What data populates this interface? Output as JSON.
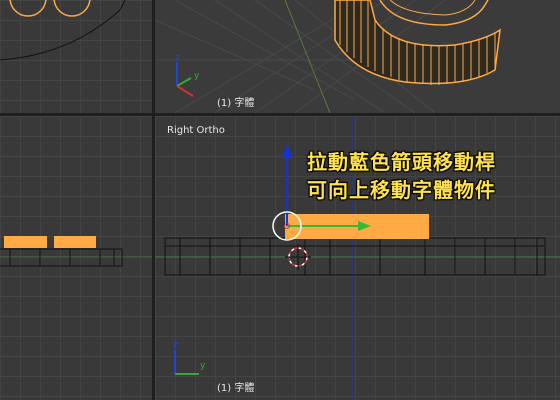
{
  "viewports": {
    "top_right": {
      "label": "(1) 字體"
    },
    "bottom_right": {
      "view_name": "Right Ortho",
      "label": "(1) 字體"
    }
  },
  "annotation": {
    "line1": "拉動藍色箭頭移動桿",
    "line2": "可向上移動字體物件"
  },
  "axis_labels": {
    "x": "x",
    "y": "y",
    "z": "z"
  },
  "colors": {
    "selection": "#ffaa44",
    "axis_x": "#cc3333",
    "axis_y": "#33aa33",
    "axis_z": "#2244dd",
    "annotation_text": "#ffe24d"
  }
}
